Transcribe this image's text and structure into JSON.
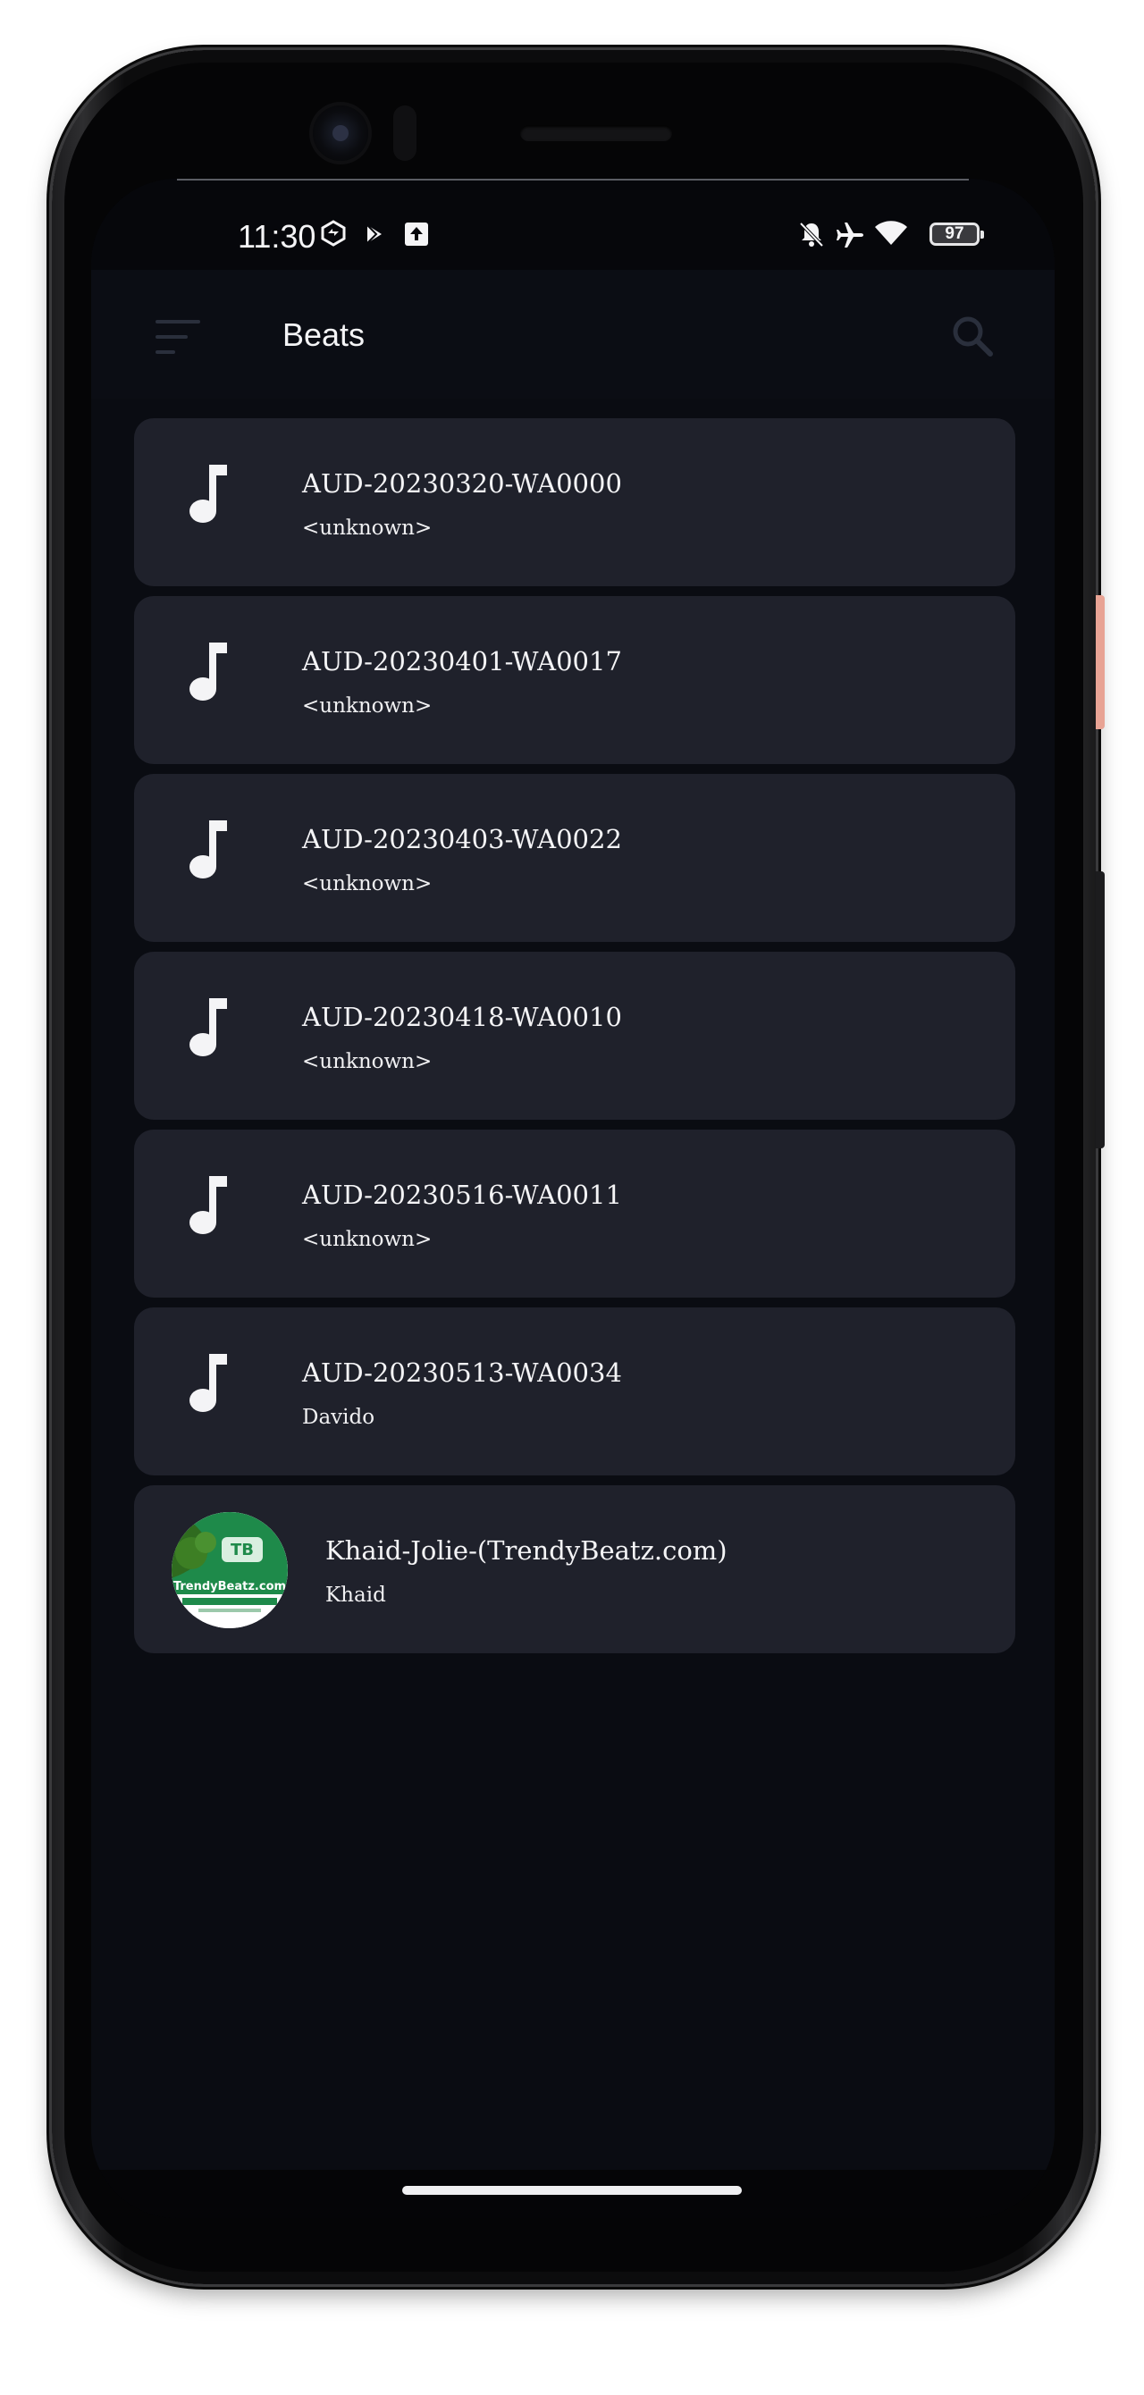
{
  "status_bar": {
    "time": "11:30",
    "battery": "97",
    "left_icons": [
      "sync-badge-icon",
      "play-store-icon",
      "upload-icon"
    ],
    "right_icons": [
      "bell-off-icon",
      "airplane-icon",
      "wifi-icon",
      "battery-icon"
    ]
  },
  "app_bar": {
    "title": "Beats",
    "menu_icon": "sort-menu-icon",
    "search_icon": "search-icon"
  },
  "songs": [
    {
      "title": "AUD-20230320-WA0000",
      "artist": "<unknown>",
      "artwork": "music-note-icon"
    },
    {
      "title": "AUD-20230401-WA0017",
      "artist": "<unknown>",
      "artwork": "music-note-icon"
    },
    {
      "title": "AUD-20230403-WA0022",
      "artist": "<unknown>",
      "artwork": "music-note-icon"
    },
    {
      "title": "AUD-20230418-WA0010",
      "artist": "<unknown>",
      "artwork": "music-note-icon"
    },
    {
      "title": "AUD-20230516-WA0011",
      "artist": "<unknown>",
      "artwork": "music-note-icon"
    },
    {
      "title": "AUD-20230513-WA0034",
      "artist": "Davido",
      "artwork": "music-note-icon"
    },
    {
      "title": "Khaid-Jolie-(TrendyBeatz.com)",
      "artist": "Khaid",
      "artwork": "album-art-image",
      "art_logo_text": "TrendyBeatz.com"
    }
  ],
  "colors": {
    "background": "#0a0c12",
    "card": "#1f212b",
    "text": "#f4f4f6",
    "muted_icon": "#2a2f3c",
    "album_green": "#1e8a4a"
  }
}
